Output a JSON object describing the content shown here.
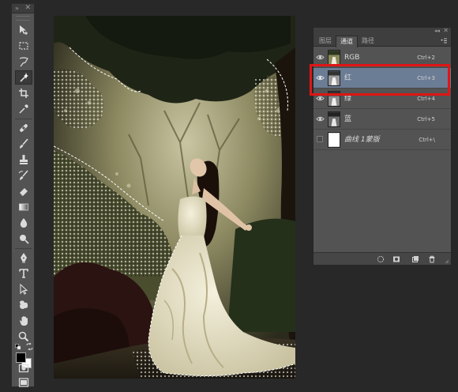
{
  "panel": {
    "tabs": [
      {
        "label": "图层"
      },
      {
        "label": "通道"
      },
      {
        "label": "路径"
      }
    ],
    "channels": [
      {
        "name": "RGB",
        "shortcut": "Ctrl+2",
        "visible": true,
        "selected": false
      },
      {
        "name": "红",
        "shortcut": "Ctrl+3",
        "visible": true,
        "selected": true
      },
      {
        "name": "绿",
        "shortcut": "Ctrl+4",
        "visible": true,
        "selected": false
      },
      {
        "name": "蓝",
        "shortcut": "Ctrl+5",
        "visible": true,
        "selected": false
      },
      {
        "name": "曲线 1蒙版",
        "shortcut": "Ctrl+\\",
        "visible": false,
        "selected": false
      }
    ],
    "active_tab": "通道",
    "selected_row_color": "#6b7c95"
  },
  "toolbox": {
    "foreground_color": "#000000",
    "background_color": "#ffffff",
    "active_tool": "magic-wand-icon",
    "tools": [
      "move-icon",
      "marquee-icon",
      "lasso-icon",
      "magic-wand-icon",
      "crop-icon",
      "eyedropper-icon",
      "healing-brush-icon",
      "brush-icon",
      "clone-stamp-icon",
      "history-brush-icon",
      "eraser-icon",
      "gradient-icon",
      "blur-icon",
      "dodge-icon",
      "pen-icon",
      "type-icon",
      "path-selection-icon",
      "shape-icon",
      "hand-icon",
      "zoom-icon",
      "quick-mask-icon",
      "screen-mode-icon"
    ]
  },
  "highlight": {
    "color": "#e01515"
  }
}
